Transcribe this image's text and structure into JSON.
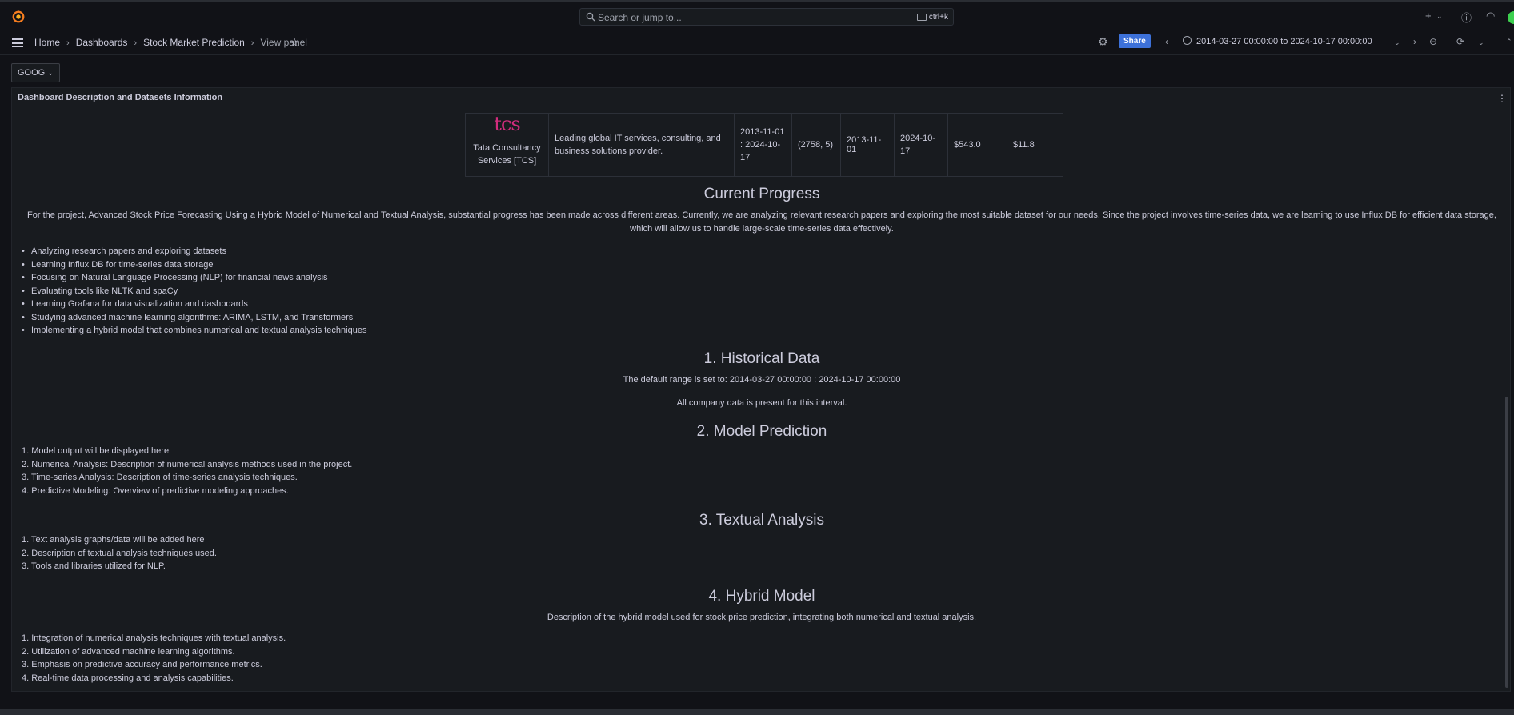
{
  "topbar": {
    "search_placeholder": "Search or jump to...",
    "search_shortcut": "ctrl+k"
  },
  "breadcrumb": {
    "home": "Home",
    "dashboards": "Dashboards",
    "dashboard": "Stock Market Prediction",
    "current": "View panel"
  },
  "toolbar": {
    "share_label": "Share",
    "time_range": "2014-03-27 00:00:00 to 2024-10-17 00:00:00"
  },
  "variable": {
    "value": "GOOG"
  },
  "panel": {
    "title": "Dashboard Description and Datasets Information",
    "company_row": {
      "logo_text": "tcs",
      "name": "Tata Consultancy Services [TCS]",
      "description": "Leading global IT services, consulting, and business solutions provider.",
      "range": "2013-11-01 : 2024-10-17",
      "shape": "(2758, 5)",
      "start": "2013-11-01",
      "end": "2024-10-17",
      "max_price": "$543.0",
      "min_price": "$11.8"
    },
    "progress": {
      "heading": "Current Progress",
      "intro": "For the project, Advanced Stock Price Forecasting Using a Hybrid Model of Numerical and Textual Analysis, substantial progress has been made across different areas. Currently, we are analyzing relevant research papers and exploring the most suitable dataset for our needs. Since the project involves time-series data, we are learning to use Influx DB for efficient data storage, which will allow us to handle large-scale time-series data effectively.",
      "items": [
        "Analyzing research papers and exploring datasets",
        "Learning Influx DB for time-series data storage",
        "Focusing on Natural Language Processing (NLP) for financial news analysis",
        "Evaluating tools like NLTK and spaCy",
        "Learning Grafana for data visualization and dashboards",
        "Studying advanced machine learning algorithms: ARIMA, LSTM, and Transformers",
        "Implementing a hybrid model that combines numerical and textual analysis techniques"
      ]
    },
    "historical": {
      "heading": "1. Historical Data",
      "line1": "The default range is set to: 2014-03-27 00:00:00 : 2024-10-17 00:00:00",
      "line2": "All company data is present for this interval."
    },
    "model": {
      "heading": "2. Model Prediction",
      "items": [
        "1. Model output will be displayed here",
        "2. Numerical Analysis: Description of numerical analysis methods used in the project.",
        "3. Time-series Analysis: Description of time-series analysis techniques.",
        "4. Predictive Modeling: Overview of predictive modeling approaches."
      ]
    },
    "textual": {
      "heading": "3. Textual Analysis",
      "items": [
        "1. Text analysis graphs/data will be added here",
        "2. Description of textual analysis techniques used.",
        "3. Tools and libraries utilized for NLP."
      ]
    },
    "hybrid": {
      "heading": "4. Hybrid Model",
      "description": "Description of the hybrid model used for stock price prediction, integrating both numerical and textual analysis.",
      "items": [
        "1. Integration of numerical analysis techniques with textual analysis.",
        "2. Utilization of advanced machine learning algorithms.",
        "3. Emphasis on predictive accuracy and performance metrics.",
        "4. Real-time data processing and analysis capabilities."
      ]
    }
  }
}
